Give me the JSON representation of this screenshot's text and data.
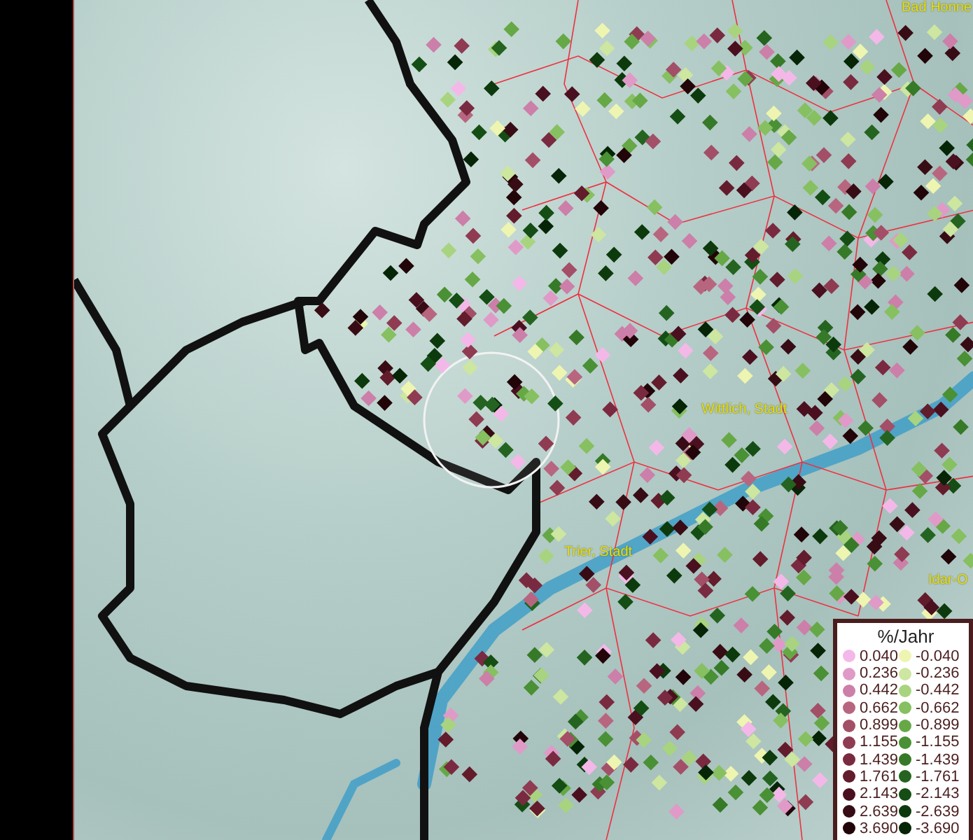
{
  "map": {
    "place_labels": [
      {
        "text": "Bad Honne"
      },
      {
        "text": "Wittlich, Stadt"
      },
      {
        "text": "Trier, Stadt"
      },
      {
        "text": "Idar-O"
      }
    ]
  },
  "legend": {
    "title": "%/Jahr",
    "columns": [
      [
        {
          "value": "0.040",
          "color": "#f4b8e8"
        },
        {
          "value": "0.236",
          "color": "#e09ac8"
        },
        {
          "value": "0.442",
          "color": "#cc7fa8"
        },
        {
          "value": "0.662",
          "color": "#b8667f"
        },
        {
          "value": "0.899",
          "color": "#a34f68"
        },
        {
          "value": "1.155",
          "color": "#8f3b52"
        },
        {
          "value": "1.439",
          "color": "#7a2a40"
        },
        {
          "value": "1.761",
          "color": "#621c2c"
        },
        {
          "value": "2.143",
          "color": "#4a1020"
        },
        {
          "value": "2.639",
          "color": "#380c14"
        },
        {
          "value": "3.690",
          "color": "#220508"
        }
      ],
      [
        {
          "value": "-0.040",
          "color": "#eef5b0"
        },
        {
          "value": "-0.236",
          "color": "#cde6a0"
        },
        {
          "value": "-0.442",
          "color": "#a8d47f"
        },
        {
          "value": "-0.662",
          "color": "#86c060"
        },
        {
          "value": "-0.899",
          "color": "#66a846"
        },
        {
          "value": "-1.155",
          "color": "#4a9034"
        },
        {
          "value": "-1.439",
          "color": "#367a28"
        },
        {
          "value": "-1.761",
          "color": "#246420"
        },
        {
          "value": "-2.143",
          "color": "#144e14"
        },
        {
          "value": "-2.639",
          "color": "#0c3a0c"
        },
        {
          "value": "-3.690",
          "color": "#062406"
        }
      ]
    ]
  }
}
